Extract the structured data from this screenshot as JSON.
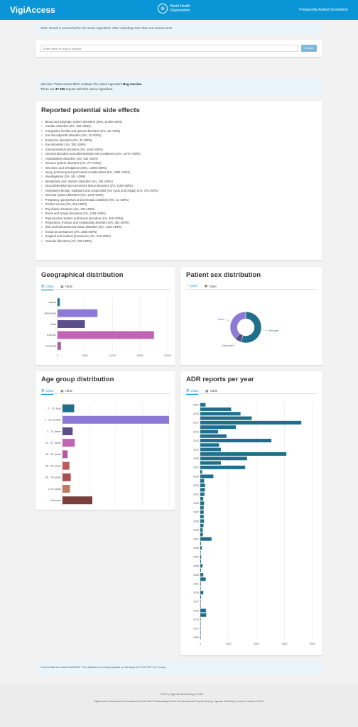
{
  "header": {
    "brand": "VigiAccess",
    "who_line1": "World Health",
    "who_line2": "Organization",
    "faq": "Frequently Asked Questions"
  },
  "note": "Note: Result is presented for the active ingredient, often including more than one brand name",
  "search": {
    "placeholder": "Enter name of drug or vaccine",
    "button": "Search"
  },
  "info": {
    "line1_prefix": "Vaccines Tuberculosis BCG contains the active ingredient ",
    "ingredient": "Bcg vaccine",
    "line2_prefix": "There are ",
    "count": "37 326",
    "line2_suffix": " reports with this active ingredient"
  },
  "side_effects": {
    "title": "Reported potential side effects",
    "items": [
      "Blood and lymphatic system disorders (20%, 11466 ADRs)",
      "Cardiac disorders (0%, 203 ADRs)",
      "Congenital, familial and genetic disorders (0%, 92 ADRs)",
      "Ear and labyrinth disorders (0%, 32 ADRs)",
      "Endocrine disorders (0%, 37 ADRs)",
      "Eye disorders (1%, 391 ADRs)",
      "Gastrointestinal disorders (2%, 1045 ADRs)",
      "General disorders and administration site conditions (21%, 11757 ADRs)",
      "Hepatobiliary disorders (1%, 324 ADRs)",
      "Immune system disorders (1%, 377 ADRs)",
      "Infections and infestations (25%, 14093 ADRs)",
      "Injury, poisoning and procedural complications (5%, 2681 ADRs)",
      "Investigations (2%, 911 ADRs)",
      "Metabolism and nutrition disorders (1%, 291 ADRs)",
      "Musculoskeletal and connective tissue disorders (2%, 1293 ADRs)",
      "Neoplasms benign, malignant and unspecified (incl cysts and polyps) (1%, 376 ADRs)",
      "Nervous system disorders (3%, 1434 ADRs)",
      "Pregnancy, puerperium and perinatal conditions (0%, 42 ADRs)",
      "Product issues (0%, 263 ADRs)",
      "Psychiatric disorders (1%, 434 ADRs)",
      "Renal and urinary disorders (2%, 1292 ADRs)",
      "Reproductive system and breast disorders (1%, 300 ADRs)",
      "Respiratory, thoracic and mediastinal disorders (2%, 931 ADRs)",
      "Skin and subcutaneous tissue disorders (4%, 2104 ADRs)",
      "Social circumstances (3%, 2355 ADRs)",
      "Surgical and medical procedures (1%, 314 ADRs)",
      "Vascular disorders (1%, 708 ADRs)"
    ]
  },
  "tabs": {
    "chart": "Chart",
    "table": "Table"
  },
  "chart_data": [
    {
      "type": "bar",
      "orientation": "horizontal",
      "title": "Geographical distribution",
      "categories": [
        "Africa",
        "Americas",
        "Asia",
        "Europe",
        "Oceania"
      ],
      "values": [
        450,
        8200,
        5600,
        19800,
        700
      ],
      "xlim": [
        0,
        22600
      ],
      "ticks": [
        "0",
        "5500",
        "11000",
        "16500",
        "22600"
      ],
      "colors": [
        "#1f6f8b",
        "#8c7ad6",
        "#5a4f8a",
        "#c064b3",
        "#b05aa0"
      ],
      "grid": true
    },
    {
      "type": "pie",
      "title": "Patient sex distribution",
      "categories": [
        "Female",
        "Unknown",
        "Male"
      ],
      "values": [
        55,
        7,
        38
      ],
      "colors": [
        "#1f6f8b",
        "#5a4f8a",
        "#8c7ad6"
      ]
    },
    {
      "type": "bar",
      "orientation": "horizontal",
      "title": "Age group distribution",
      "categories": [
        "0 - 27 days",
        "1 - 23 months",
        "2 - 11 years",
        "12 - 17 years",
        "18 - 44 years",
        "45 - 64 years",
        "65 - 74 years",
        "≥ 75 years",
        "Unknown"
      ],
      "values": [
        2200,
        20000,
        1900,
        2300,
        950,
        1300,
        1550,
        1400,
        5600
      ],
      "xlim": [
        0,
        20000
      ],
      "ticks": [
        "0",
        "5000",
        "10000",
        "15000",
        "20000"
      ],
      "colors": [
        "#1f6f8b",
        "#8c7ad6",
        "#5a4f8a",
        "#c064b3",
        "#b05aa0",
        "#c05a5a",
        "#a85050",
        "#c07a63",
        "#7a3f3a"
      ],
      "grid": true
    },
    {
      "type": "bar",
      "orientation": "horizontal",
      "title": "ADR reports per year",
      "categories": [
        "2021",
        "",
        "2019",
        "",
        "2017",
        "",
        "2015",
        "",
        "2013",
        "",
        "2011",
        "",
        "2009",
        "",
        "2007",
        "",
        "2005",
        "",
        "2003",
        "",
        "2001",
        "",
        "1999",
        "",
        "1997",
        "",
        "1995",
        "",
        "1993",
        "",
        "1991",
        "",
        "1989",
        "",
        "1987",
        "",
        "1985",
        "",
        "1983",
        "",
        "1981",
        "",
        "1979",
        "",
        "1977",
        "",
        "1975",
        "",
        "1973",
        "",
        "1971",
        "",
        "1969"
      ],
      "values": [
        280,
        1650,
        2150,
        2750,
        5400,
        1900,
        950,
        1400,
        3800,
        1000,
        1100,
        4600,
        2500,
        1100,
        2400,
        100,
        700,
        200,
        250,
        250,
        220,
        160,
        200,
        180,
        180,
        180,
        200,
        170,
        130,
        140,
        600,
        40,
        80,
        20,
        50,
        40,
        120,
        40,
        160,
        290,
        30,
        20,
        160,
        40,
        20,
        20,
        300,
        320,
        20,
        20,
        20,
        20,
        10
      ],
      "xlim": [
        0,
        6000
      ],
      "ticks": [
        "0",
        "1500",
        "3000",
        "4500",
        "6000"
      ],
      "color": "#1f6f8b",
      "grid": true
    }
  ],
  "footer_note": "Current data are dated 6/30/2022. The dataset is normally updated on Sundays at 17:00 CET (1-7 hours).",
  "footer": {
    "logos": "WHO | Uppsala Monitoring Centre",
    "text": "VigiAccess is developed and maintained by the WHO Collaborating Centre for International Drug Monitoring, Uppsala Monitoring Centre on behalf of WHO"
  }
}
